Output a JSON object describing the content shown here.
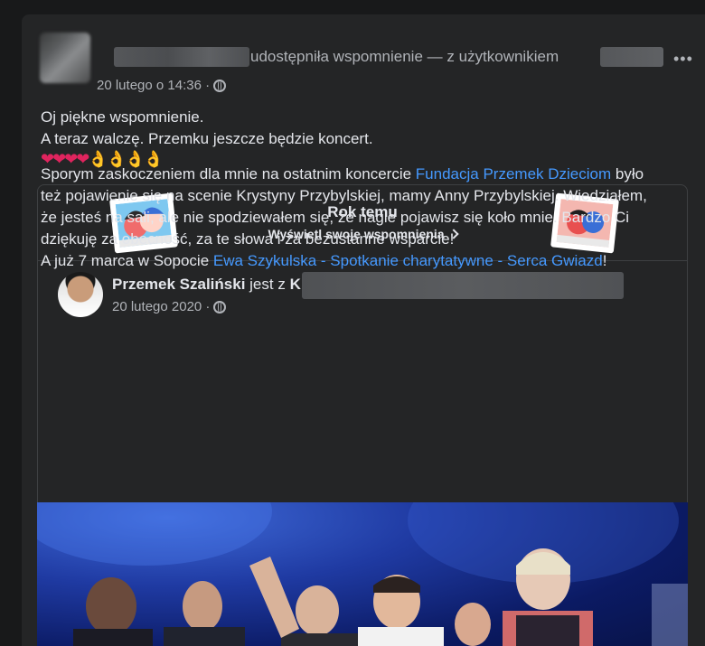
{
  "outer_post": {
    "action_text": "udostępniła wspomnienie — z użytkownikiem",
    "more_label": "•••",
    "timestamp": "20 lutego o 14:36 ·",
    "text_lines": [
      "Oj piękne wspomnienie.",
      "A teraz walczę. Przemku jeszcze będzie koncert."
    ],
    "emojis": {
      "hearts": "❤❤❤❤",
      "ok_hands": "👌👌👌👌"
    }
  },
  "memory": {
    "title": "Rok temu",
    "link_label": "Wyświetl swoje wspomnienia"
  },
  "inner_post": {
    "author": "Przemek Szaliński",
    "with_text": "jest z",
    "with_initial": "K",
    "timestamp": "20 lutego 2020 ·",
    "text_part1": "Sporym zaskoczeniem dla mnie na ostatnim koncercie ",
    "link1": "Fundacja Przemek Dzieciom",
    "text_part2": " było też pojawienie się na scenie Krystyny Przybylskiej, mamy Anny Przybylskiej. Wiedziałem, że jesteś na sali, ale nie spodziewałem się, że nagle pojawisz się koło mnie. Bardzo Ci dziękuję za obecność, za te słowa i za bezustanne wsparcie!",
    "text_part3": "A już 7 marca w Sopocie ",
    "link2": "Ewa Szykulska - Spotkanie charytatywne - Serca Gwiazd",
    "text_part4": "!"
  },
  "colors": {
    "background": "#18191a",
    "card": "#242526",
    "link": "#4599ff",
    "secondary_text": "#b0b3b8",
    "primary_text": "#e4e6eb"
  },
  "icons": [
    "globe-icon",
    "more-icon",
    "chevron-right-icon",
    "memory-illustration-icon"
  ]
}
